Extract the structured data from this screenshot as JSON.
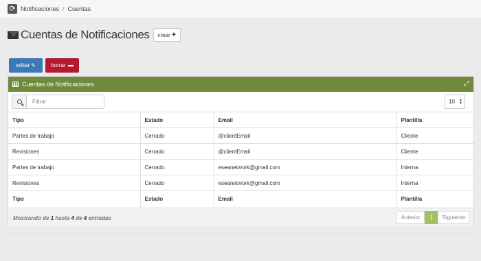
{
  "breadcrumb": {
    "items": [
      "Notificaciones",
      "Cuentas"
    ],
    "separator": "/"
  },
  "header": {
    "title": "Cuentas de Notificaciones",
    "create_label": "crear"
  },
  "actions": {
    "edit_label": "editar",
    "delete_label": "borrar"
  },
  "panel": {
    "title": "Cuentas de Notificaciones",
    "filter_placeholder": "Filtrar",
    "page_size": "10"
  },
  "table": {
    "columns": [
      "Tipo",
      "Estado",
      "Email",
      "Plantilla"
    ],
    "rows": [
      [
        "Partes de trabajo",
        "Cerrado",
        "@clientEmail",
        "Cliente"
      ],
      [
        "Revisiones",
        "Cerrado",
        "@clientEmail",
        "Cliente"
      ],
      [
        "Partes de trabajo",
        "Cerrado",
        "eseanetwork@gmail.com",
        "Interna"
      ],
      [
        "Revisiones",
        "Cerrado",
        "eseanetwork@gmail.com",
        "Interna"
      ]
    ]
  },
  "footer": {
    "info_prefix": "Mostrando de",
    "info_start": "1",
    "info_mid": "hasta",
    "info_end": "4",
    "info_of": "de",
    "info_total": "4",
    "info_suffix": "entradas",
    "prev_label": "Anterior",
    "current_page": "1",
    "next_label": "Siguiente"
  },
  "colors": {
    "panel_header": "#6f8a3c",
    "edit_button": "#3a78b7",
    "delete_button": "#b5192f",
    "active_page": "#a4c063"
  },
  "icons": [
    "refresh-icon",
    "envelope-icon",
    "plus-icon",
    "pencil-icon",
    "minus-icon",
    "table-icon",
    "expand-icon",
    "search-icon"
  ]
}
